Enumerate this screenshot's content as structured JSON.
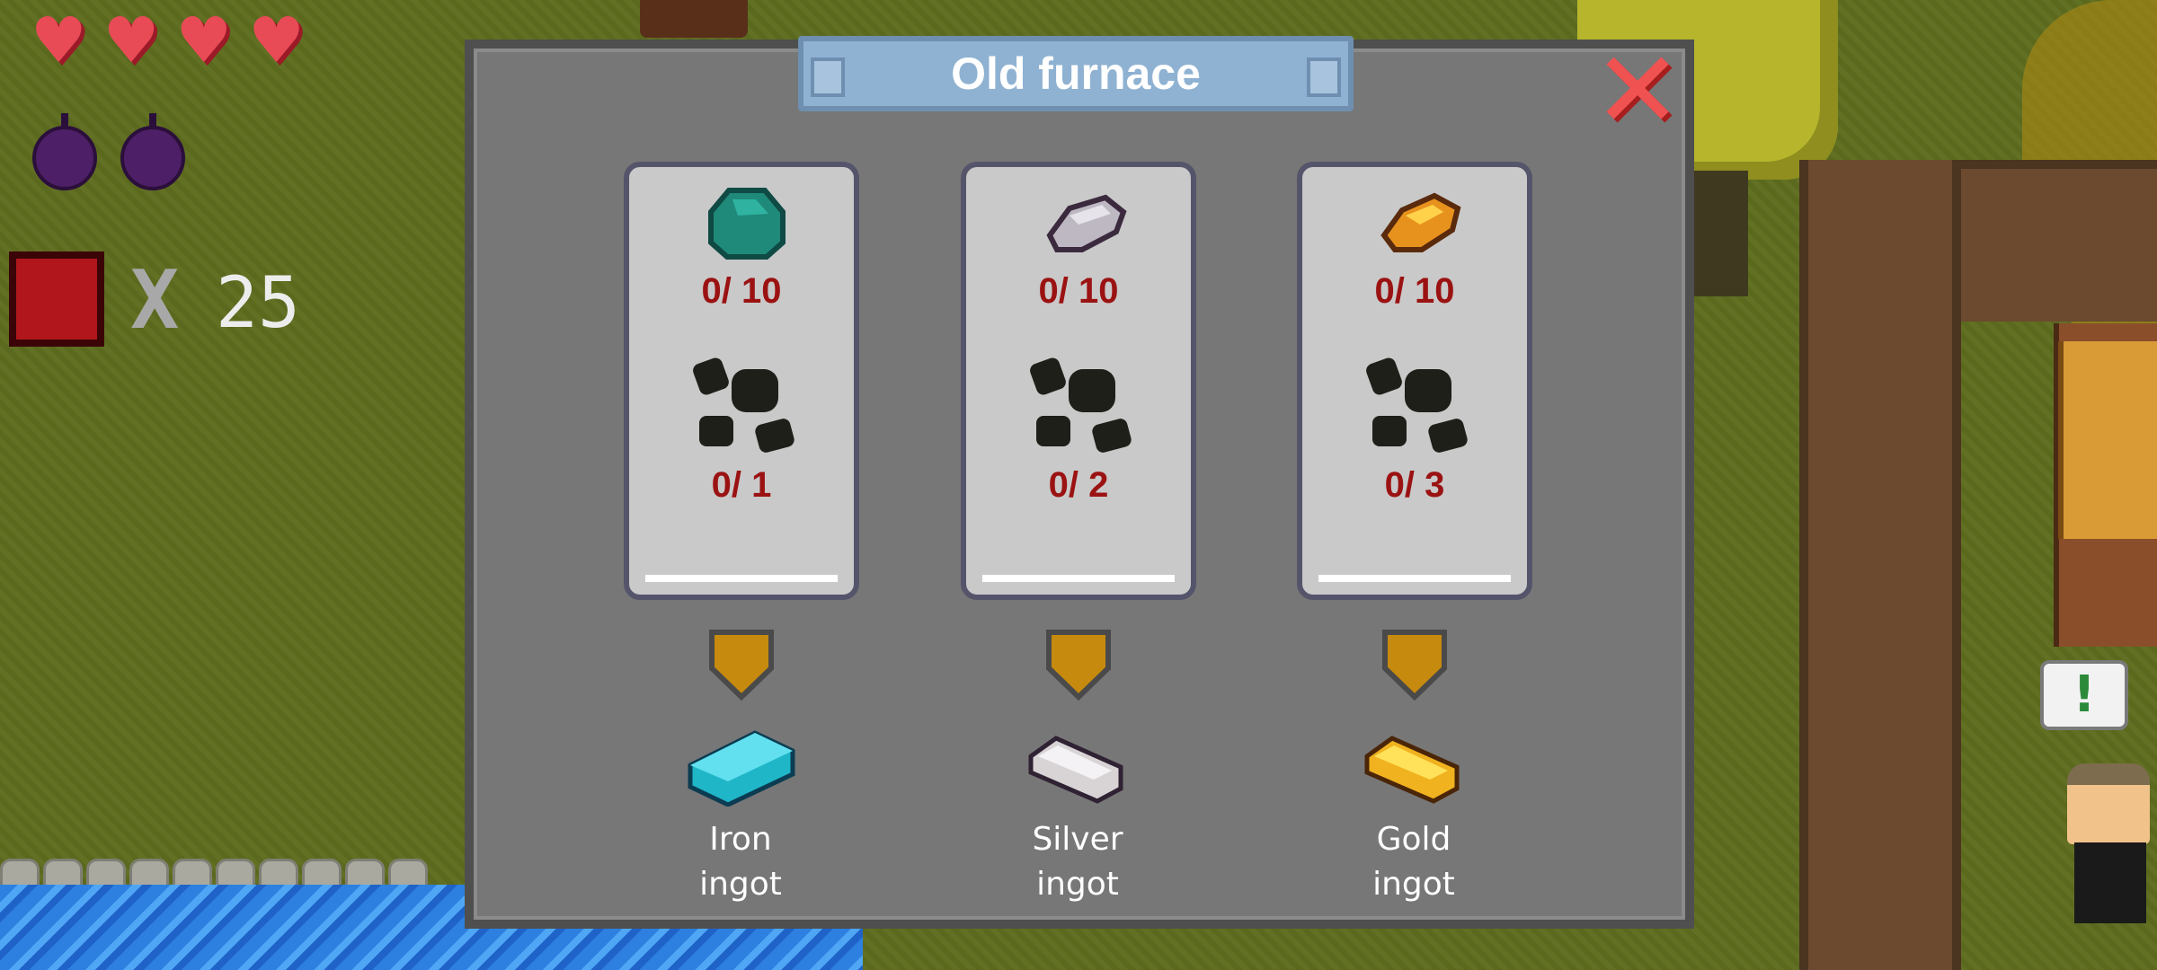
{
  "hud": {
    "hearts": [
      "heart-full",
      "heart-full",
      "heart-full",
      "heart-full"
    ],
    "bombs": [
      "bomb",
      "bomb"
    ],
    "resource_multiplier": "X",
    "resource_count": "25"
  },
  "dialog": {
    "title": "Old furnace",
    "close_icon": "close-x-icon",
    "recipes": [
      {
        "ore_icon": "iron-ore-icon",
        "ore_progress": "0/ 10",
        "coal_icon": "coal-icon",
        "coal_progress": "0/ 1",
        "arrow_icon": "arrow-down-icon",
        "output_icon": "iron-ingot-icon",
        "output_line1": "Iron",
        "output_line2": "ingot",
        "ore_color": "#1f8a7a",
        "ingot_color": "#1fb6c8"
      },
      {
        "ore_icon": "silver-ore-icon",
        "ore_progress": "0/ 10",
        "coal_icon": "coal-icon",
        "coal_progress": "0/ 2",
        "arrow_icon": "arrow-down-icon",
        "output_icon": "silver-ingot-icon",
        "output_line1": "Silver",
        "output_line2": "ingot",
        "ore_color": "#bdb8c2",
        "ingot_color": "#d8d4d6"
      },
      {
        "ore_icon": "gold-ore-icon",
        "ore_progress": "0/ 10",
        "coal_icon": "coal-icon",
        "coal_progress": "0/ 3",
        "arrow_icon": "arrow-down-icon",
        "output_icon": "gold-ingot-icon",
        "output_line1": "Gold",
        "output_line2": "ingot",
        "ore_color": "#e8921e",
        "ingot_color": "#f0b21e"
      }
    ]
  },
  "npc": {
    "speech": "!"
  },
  "colors": {
    "panel": "#777777",
    "title_banner": "#8fb2d2",
    "counter_text": "#9b1212",
    "arrow": "#c68a0e",
    "close": "#f05252"
  }
}
